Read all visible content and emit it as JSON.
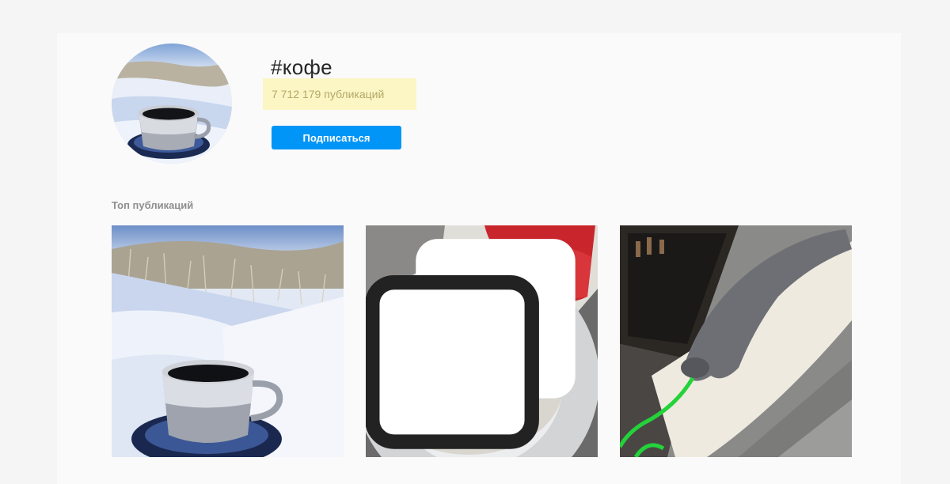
{
  "hashtag": {
    "title": "#кофе",
    "post_count": "7 712 179",
    "post_count_label": "публикаций",
    "follow_label": "Подписаться"
  },
  "top_posts": {
    "title": "Топ публикаций"
  },
  "icons": {
    "carousel": "multiple-photos-icon"
  },
  "colors": {
    "follow_button": "#0095f6",
    "highlight": "#fbf6c4"
  }
}
